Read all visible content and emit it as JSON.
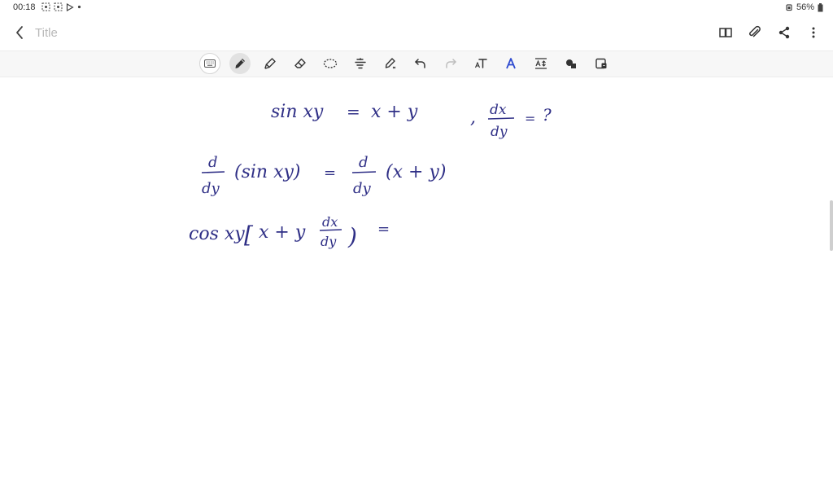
{
  "status_bar": {
    "time": "00:18",
    "battery": "56%"
  },
  "header": {
    "title_placeholder": "Title"
  },
  "icons": {
    "back": "chevron-left-icon",
    "book": "book-open-icon",
    "attach": "paperclip-icon",
    "share": "share-icon",
    "more": "more-vertical-icon",
    "keyboard": "keyboard-icon",
    "pen": "pen-icon",
    "highlighter": "highlighter-icon",
    "eraser": "eraser-icon",
    "lasso": "lasso-icon",
    "text_align": "text-align-icon",
    "pen_settings": "pen-settings-icon",
    "undo": "undo-icon",
    "redo": "redo-icon",
    "text_tool": "text-tool-icon",
    "handwriting": "handwriting-icon",
    "text_size": "text-size-icon",
    "shapes": "shapes-icon",
    "image": "image-insert-icon"
  },
  "colors": {
    "ink": "#2f2f86",
    "toolbar_bg": "#f7f7f7"
  },
  "handwriting": {
    "line1": {
      "lhs": "sin xy",
      "eq": "=",
      "rhs": "x + y",
      "comma": ",",
      "frac_num": "dx",
      "frac_den": "dy",
      "eq2": "=",
      "question": "?"
    },
    "line2": {
      "d_num": "d",
      "d_den": "dy",
      "lhs": "(sin xy)",
      "eq": "=",
      "d2_num": "d",
      "d2_den": "dy",
      "rhs": "(x + y)"
    },
    "line3": {
      "cos": "cos xy",
      "bracket_open": "[",
      "inner": "x + y",
      "frac_num": "dx",
      "frac_den": "dy",
      "bracket_close": ")",
      "eq": "="
    }
  }
}
